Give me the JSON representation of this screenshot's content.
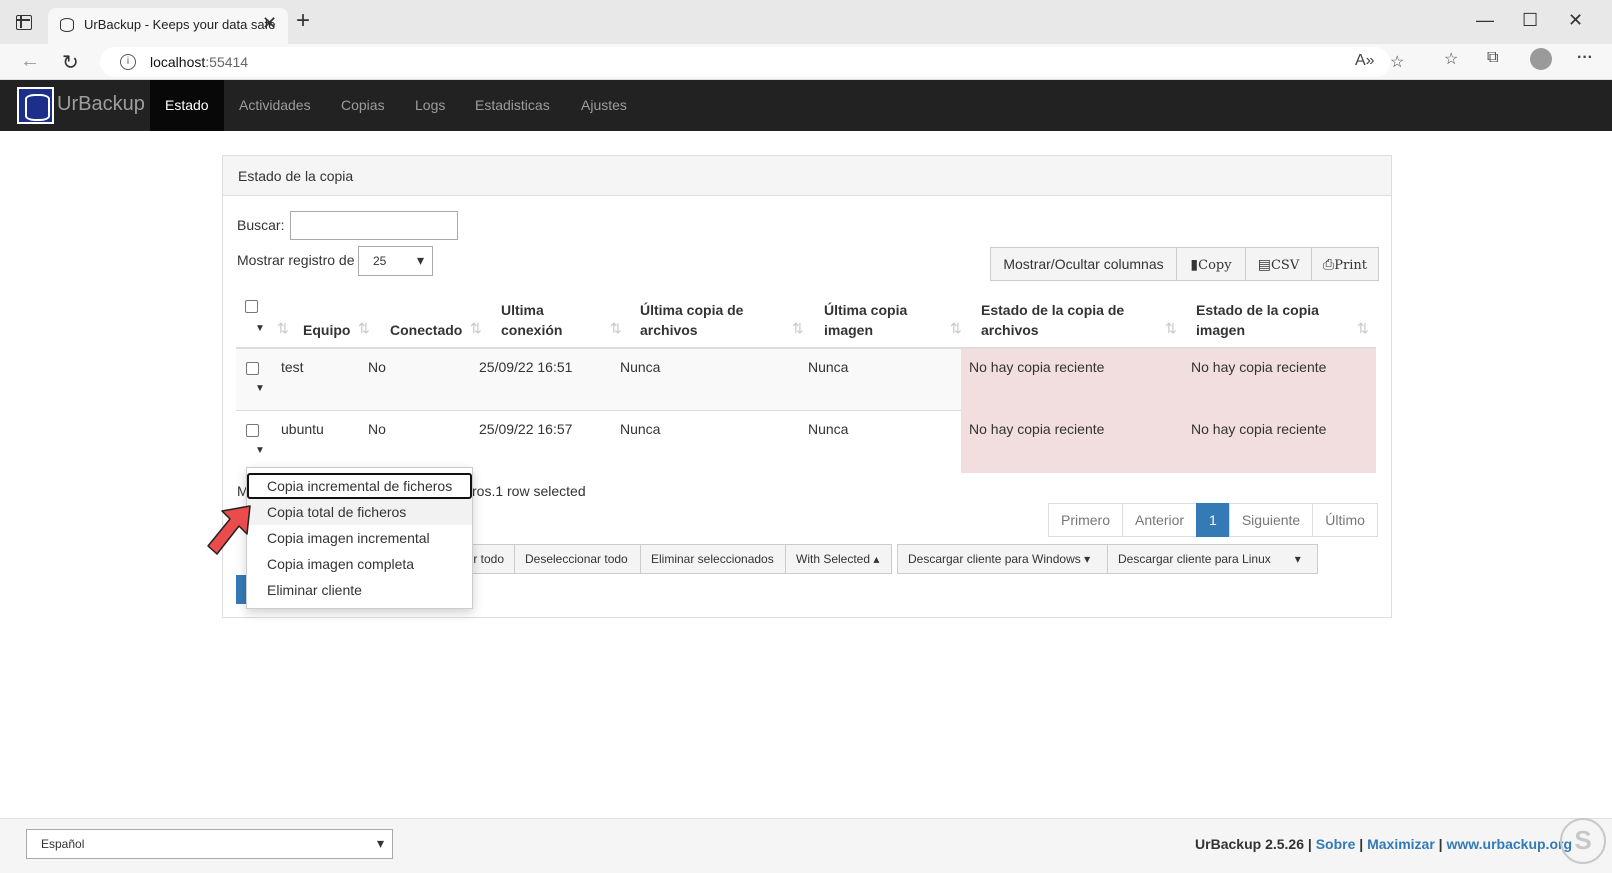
{
  "browser": {
    "tab_title": "UrBackup - Keeps your data safe",
    "url_host": "localhost",
    "url_port": ":55414"
  },
  "app": {
    "brand": "UrBackup",
    "nav": [
      "Estado",
      "Actividades",
      "Copias",
      "Logs",
      "Estadisticas",
      "Ajustes"
    ],
    "active_nav": "Estado"
  },
  "panel": {
    "heading": "Estado de la copia",
    "search_label": "Buscar:",
    "search_value": "",
    "length_label": "Mostrar registro de",
    "length_value": "25",
    "buttons": {
      "columns": "Mostrar/Ocultar columnas",
      "copy": "Copy",
      "csv": "CSV",
      "print": "Print"
    }
  },
  "table": {
    "columns": [
      "Equipo",
      "Conectado",
      "Ultima conexión",
      "Última copia de archivos",
      "Última copia imagen",
      "Estado de la copia de archivos",
      "Estado de la copia imagen"
    ],
    "rows": [
      [
        "test",
        "No",
        "25/09/22 16:51",
        "Nunca",
        "Nunca",
        "No hay copia reciente",
        "No hay copia reciente"
      ],
      [
        "ubuntu",
        "No",
        "25/09/22 16:57",
        "Nunca",
        "Nunca",
        "No hay copia reciente",
        "No hay copia reciente"
      ]
    ]
  },
  "info": {
    "prefix": "M",
    "suffix": "ros.1 row selected"
  },
  "pagination": {
    "first": "Primero",
    "prev": "Anterior",
    "current": "1",
    "next": "Siguiente",
    "last": "Último"
  },
  "actions": {
    "select_all_partial": "r todo",
    "deselect_all": "Deseleccionar todo",
    "delete_selected": "Eliminar seleccionados",
    "with_selected": "With Selected",
    "download_windows": "Descargar cliente para Windows",
    "download_linux": "Descargar cliente para Linux"
  },
  "dropdown": {
    "items": [
      "Copia incremental de ficheros",
      "Copia total de ficheros",
      "Copia imagen incremental",
      "Copia imagen completa",
      "Eliminar cliente"
    ]
  },
  "footer": {
    "language": "Español",
    "version": "UrBackup 2.5.26",
    "about": "Sobre",
    "maximize": "Maximizar",
    "site": "www.urbackup.org"
  },
  "colors": {
    "navbar": "#222222",
    "danger_row": "#f2dede",
    "primary": "#337ab7",
    "annotation_arrow": "#ea4b4b"
  },
  "icons": [
    "tab-actions-icon",
    "database-icon",
    "close-icon",
    "plus-icon",
    "back-icon",
    "refresh-icon",
    "info-icon",
    "read-aloud-icon",
    "favorite-add-icon",
    "favorites-icon",
    "collections-icon",
    "profile-icon",
    "more-icon",
    "sort-icon",
    "caret-down-icon",
    "annotation-arrow-icon"
  ]
}
